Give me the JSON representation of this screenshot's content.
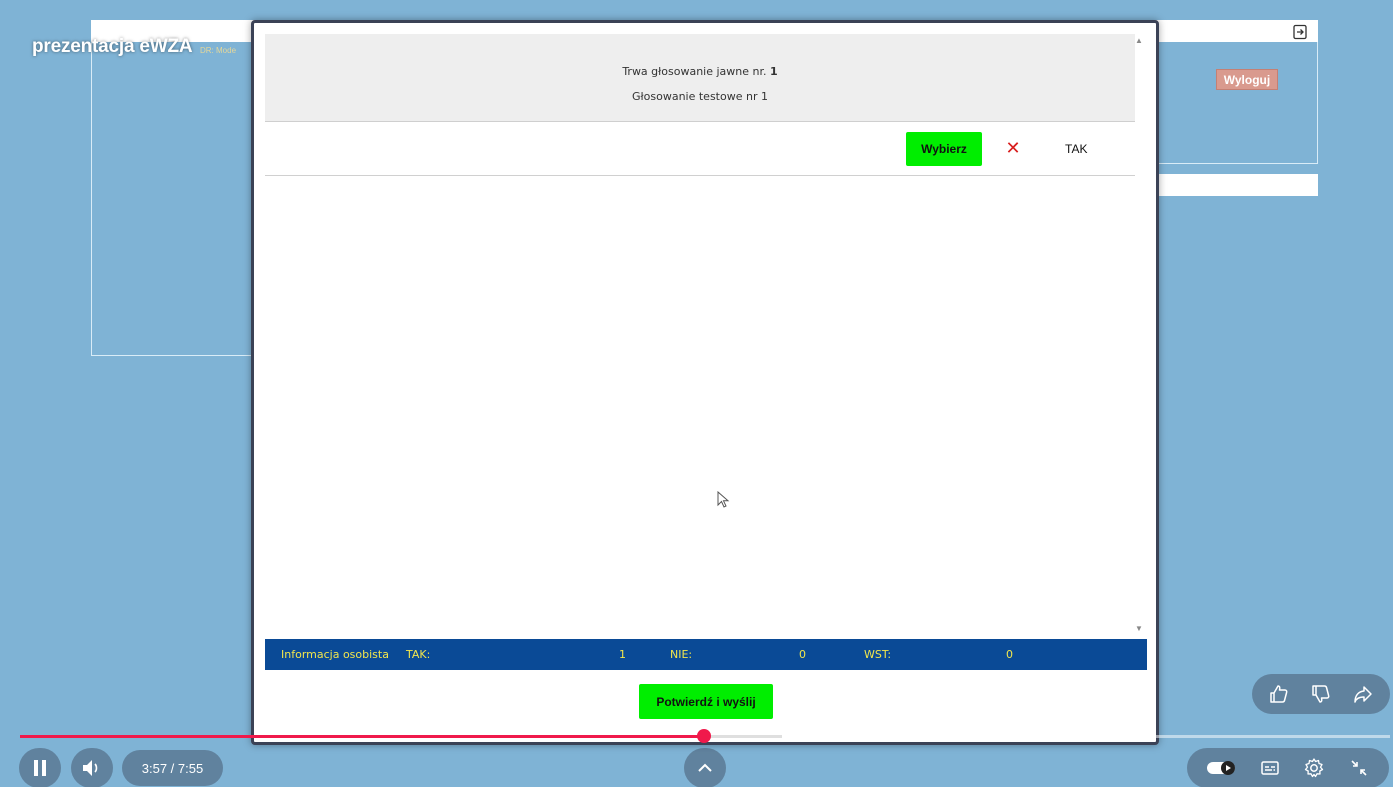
{
  "video": {
    "title": "prezentacja eWZA",
    "time": "3:57 / 7:55",
    "progress_fraction": 0.499,
    "buffered_fraction": 0.556
  },
  "background_app": {
    "small_text": "DR: Mode",
    "logout_label": "Wyloguj"
  },
  "modal": {
    "header_prefix": "Trwa głosowanie jawne nr. ",
    "vote_number": "1",
    "header_title": "Głosowanie testowe nr 1",
    "option": {
      "select_label": "Wybierz",
      "option_label": "TAK"
    },
    "info_bar": {
      "label": "Informacja osobista",
      "tak_label": "TAK:",
      "tak_value": "1",
      "nie_label": "NIE:",
      "nie_value": "0",
      "wst_label": "WST:",
      "wst_value": "0"
    },
    "submit_label": "Potwierdź i wyślij"
  },
  "icons": {
    "exit": "exit-icon",
    "close": "x-icon",
    "pause": "pause-icon",
    "volume": "volume-icon",
    "chevron": "chevron-up-icon",
    "like": "thumbs-up-icon",
    "dislike": "thumbs-down-icon",
    "share": "share-icon",
    "autoplay": "autoplay-toggle-icon",
    "captions": "captions-icon",
    "settings": "gear-icon",
    "exit_fullscreen": "exit-fullscreen-icon"
  },
  "colors": {
    "accent_green": "#00ee00",
    "info_bar_bg": "#0a4a96",
    "info_bar_text": "#f2e64c",
    "progress": "#f0194b"
  }
}
